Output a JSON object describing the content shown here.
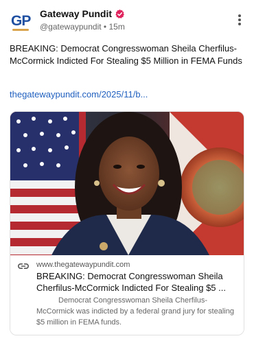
{
  "post": {
    "author_name": "Gateway Pundit",
    "avatar_initials": "GP",
    "handle": "@gatewaypundit",
    "separator": "•",
    "time": "15m",
    "text": "BREAKING: Democrat Congresswoman Sheila Cherfilus-McCormick Indicted For Stealing $5 Million in FEMA Funds",
    "link_text": "thegatewaypundit.com/2025/11/b...",
    "verified_color": "#e0245e",
    "link_color": "#1f5fbf"
  },
  "card": {
    "domain": "www.thegatewaypundit.com",
    "title": "BREAKING: Democrat Congresswoman Sheila Cherfilus-McCormick Indicted For Stealing $5 ...",
    "description": "Democrat Congresswoman Sheila Cherfilus-McCormick was indicted by a federal grand jury for stealing $5 million in FEMA funds."
  },
  "icons": {
    "verified": "verified-badge-icon",
    "more": "more-vertical-icon",
    "link": "link-icon"
  }
}
